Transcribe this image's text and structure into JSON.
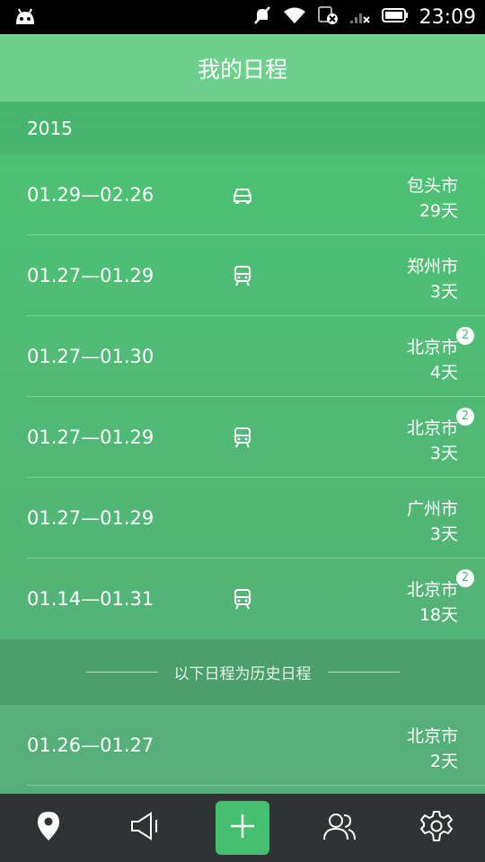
{
  "status_bar": {
    "time": "23:09"
  },
  "header": {
    "title": "我的日程"
  },
  "year_label": "2015",
  "schedules": [
    {
      "dates": "01.29—02.26",
      "transport": "car-icon",
      "city": "包头市",
      "days": "29天",
      "badge": null
    },
    {
      "dates": "01.27—01.29",
      "transport": "train-icon",
      "city": "郑州市",
      "days": "3天",
      "badge": null
    },
    {
      "dates": "01.27—01.30",
      "transport": null,
      "city": "北京市",
      "days": "4天",
      "badge": "2"
    },
    {
      "dates": "01.27—01.29",
      "transport": "train-icon",
      "city": "北京市",
      "days": "3天",
      "badge": "2"
    },
    {
      "dates": "01.27—01.29",
      "transport": null,
      "city": "广州市",
      "days": "3天",
      "badge": null
    },
    {
      "dates": "01.14—01.31",
      "transport": "train-icon",
      "city": "北京市",
      "days": "18天",
      "badge": "2"
    }
  ],
  "history_label": "以下日程为历史日程",
  "history": [
    {
      "dates": "01.26—01.27",
      "city": "北京市",
      "days": "2天"
    }
  ],
  "nav": {
    "items": [
      "location-pin-icon",
      "speaker-icon",
      "add-icon",
      "people-icon",
      "settings-gear-icon"
    ],
    "accent": "#44c06f"
  },
  "colors": {
    "header": "#6dd08d",
    "list_top": "#4cc373",
    "navbar": "#2f3333"
  }
}
